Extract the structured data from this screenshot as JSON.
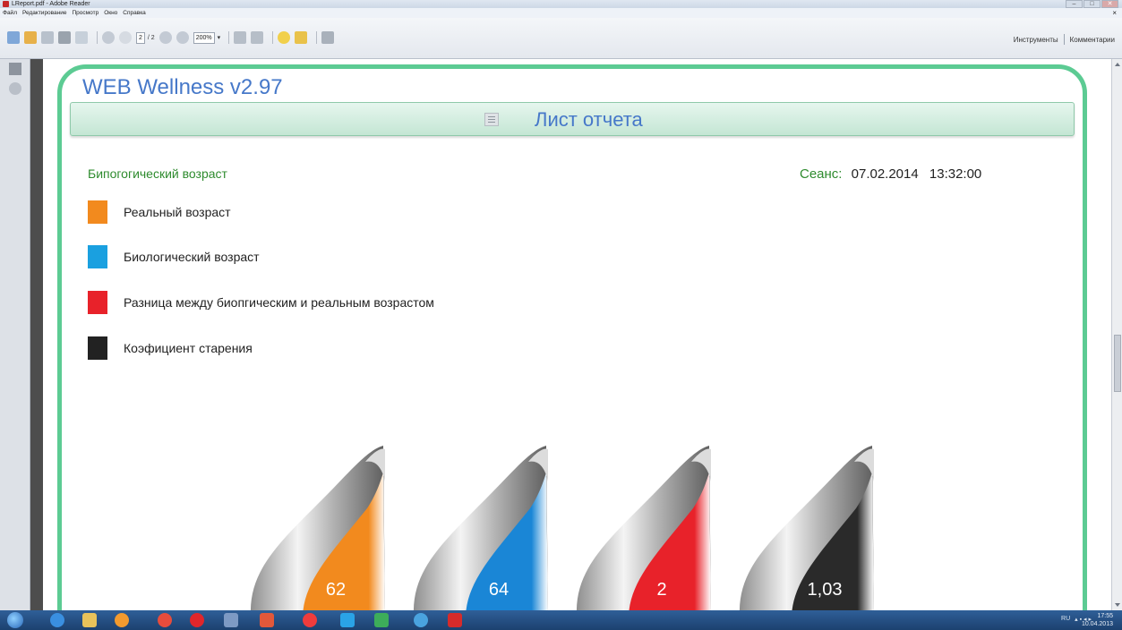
{
  "window": {
    "title": "LReport.pdf - Adobe Reader",
    "minimize": "–",
    "maximize": "□",
    "close": "✕"
  },
  "menu": {
    "items": [
      "Файл",
      "Редактирование",
      "Просмотр",
      "Окно",
      "Справка"
    ],
    "close_doc": "×"
  },
  "toolbar": {
    "page_current": "2",
    "page_total": "/ 2",
    "zoom": "200%",
    "tools_label": "Инструменты",
    "comments_label": "Комментарии"
  },
  "report": {
    "app_title": "WEB Wellness  v2.97",
    "banner_title": "Лист отчета",
    "section_title": "Бипогогический возраст",
    "session_label": "Сеанс:",
    "session_date": "07.02.2014",
    "session_time": "13:32:00"
  },
  "legend": [
    {
      "label": "Реальный возраст",
      "color": "#f28a1e"
    },
    {
      "label": "Биологический возраст",
      "color": "#1aa0e0"
    },
    {
      "label": "Разница между биопгическим и реальным возрастом",
      "color": "#e8222a"
    },
    {
      "label": "Коэфициент старения",
      "color": "#222222"
    }
  ],
  "gauges": [
    {
      "value": "62",
      "color": "#f28a1e"
    },
    {
      "value": "64",
      "color": "#1a86d6"
    },
    {
      "value": "2",
      "color": "#e8222a"
    },
    {
      "value": "1,03",
      "color": "#2a2a2a"
    }
  ],
  "taskbar": {
    "language": "RU",
    "time": "17:55",
    "date": "10.04.2013"
  },
  "icons": [
    "pdf-icon",
    "open-icon",
    "save-icon",
    "print-icon",
    "email-icon",
    "prev-page-icon",
    "next-page-icon",
    "zoom-out-icon",
    "zoom-in-icon",
    "fit-page-icon",
    "fit-width-icon",
    "comment-icon",
    "highlight-icon",
    "expand-icon",
    "pages-panel-icon",
    "attachments-icon"
  ]
}
